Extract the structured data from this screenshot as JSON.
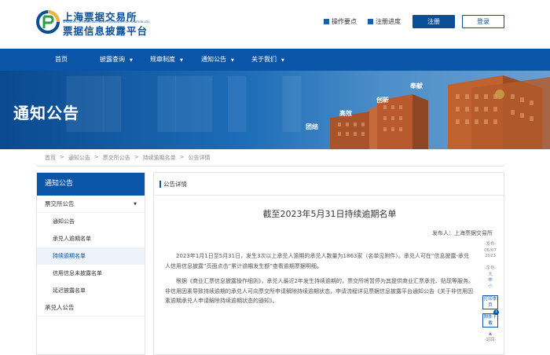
{
  "header": {
    "org_name_line1": "上海票据交易所",
    "org_name_en": "SHANGHAI COMMERCIAL PAPER EXCHANGE CORPORATION LTD.",
    "org_name_line2": "票据信息披露平台",
    "links": [
      {
        "label": "操作要点",
        "icon": "document-icon"
      },
      {
        "label": "注册进度",
        "icon": "progress-icon"
      }
    ],
    "register_label": "注册",
    "login_label": "登录"
  },
  "nav": {
    "items": [
      {
        "label": "首页",
        "dropdown": false
      },
      {
        "label": "披露查询",
        "dropdown": true
      },
      {
        "label": "规章制度",
        "dropdown": true
      },
      {
        "label": "通知公告",
        "dropdown": true
      },
      {
        "label": "关于我们",
        "dropdown": true
      }
    ]
  },
  "banner": {
    "title": "通知公告",
    "keywords": [
      "团结",
      "高效",
      "创新",
      "奉献"
    ],
    "colors": {
      "primary": "#0a55a8",
      "building": "#b85a2e"
    }
  },
  "breadcrumb": [
    "首页",
    ">",
    "通知公告",
    ">",
    "票交所公告",
    ">",
    "持续逾期名单",
    ">",
    "公告详情"
  ],
  "sidebar": {
    "title": "通知公告",
    "group1": "票交所公告",
    "items": [
      "通知公告",
      "承兑人逾期名单",
      "持续逾期名单",
      "信用信息未披露名单",
      "延迟披露名单"
    ],
    "active_index": 2,
    "group2": "承兑人公告"
  },
  "content": {
    "section_label": "公告详情",
    "title": "截至2023年5月31日持续逾期名单",
    "publisher": "发布人：上海票据交易所",
    "paragraphs": [
      "2023年1月1日至5月31日，发生3次以上承兑人逾期的承兑人数量为1863家（名单见附件）。承兑人可在“信息披露-承兑人信用信息披露”页面点击“累计逾期发生额”查看逾期票据明细。",
      "根据《商业汇票信息披露操作细则》，承兑人最近2年发生持续逾期的，票交所将暂停为其提供商业汇票承兑、贴现等服务。非信用因素导致持续逾期的承兑人可向票交所申请解除持续逾期状态，申请流程详见票据信息披露平台通知公告《关于非信用因素逾期承兑人申请解除持续逾期状态的通知》。"
    ]
  },
  "right_tools": {
    "publish_label": "-发布-",
    "publish_date_line1": "06/07",
    "publish_date_line2": "2023",
    "font_label": "-字号-",
    "font_sizes": [
      "大",
      "中",
      "小"
    ],
    "print_label": "打印本页",
    "attachment_label": "附件下载",
    "attachment_count": "1",
    "back_label": "-返回-"
  }
}
